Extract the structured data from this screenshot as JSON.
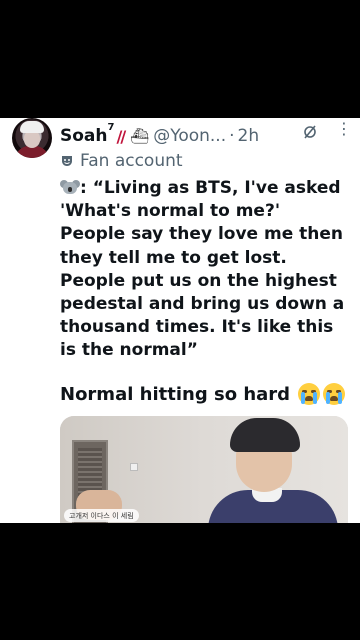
{
  "post": {
    "author_name": "Soah",
    "author_superscript": "7",
    "handle": "@Yoon...",
    "separator": "·",
    "time": "2h",
    "more_label": "⋮",
    "label": "Fan account",
    "text_prefix": ": “Living as BTS, I've asked 'What's normal to me?' People say they love me then they tell me to get lost. People put us on the highest pedestal and bring us down a thousand times. It's like this is the normal”",
    "second_line": "Normal hitting so hard",
    "media_tag": "고개저 이다스 이 세림"
  },
  "icons": {
    "avatar": "avatar-image",
    "slashes": "red-double-slash",
    "ship": "ship-emoji",
    "grok": "grok-icon",
    "more": "more-options-icon",
    "fan": "theater-masks-icon",
    "koala": "koala-emoji",
    "crying": "loudly-crying-face-emoji"
  },
  "colors": {
    "text": "#0f1419",
    "secondary": "#536471",
    "accent_red": "#c0143c"
  }
}
